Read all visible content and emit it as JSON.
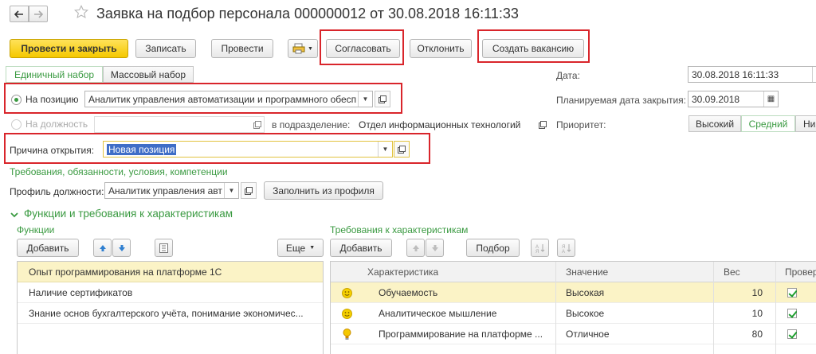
{
  "window": {
    "title": "Заявка на подбор персонала 000000012 от 30.08.2018 16:11:33"
  },
  "toolbar": {
    "post_close": "Провести и закрыть",
    "save": "Записать",
    "post": "Провести",
    "approve": "Согласовать",
    "reject": "Отклонить",
    "create_vacancy": "Создать вакансию"
  },
  "tabs": {
    "single": "Единичный набор",
    "mass": "Массовый набор"
  },
  "position": {
    "radio_label": "На позицию",
    "value": "Аналитик управления автоматизации и программного обесп"
  },
  "job": {
    "radio_label": "На должность",
    "value": "",
    "dept_label": "в подразделение:",
    "dept_value": "Отдел информационных технологий"
  },
  "reason": {
    "label": "Причина открытия:",
    "value": "Новая позиция"
  },
  "requirements_link": "Требования, обязанности, условия, компетенции",
  "profile": {
    "label": "Профиль должности:",
    "value": "Аналитик управления авт",
    "fill_button": "Заполнить из профиля"
  },
  "right": {
    "date_label": "Дата:",
    "date_value": "30.08.2018 16:11:33",
    "close_date_label": "Планируемая дата закрытия:",
    "close_date_value": "30.09.2018",
    "priority_label": "Приоритет:",
    "priority_options": [
      "Высокий",
      "Средний",
      "Ни"
    ]
  },
  "functions_section": {
    "title": "Функции и требования к характеристикам",
    "functions_title": "Функции",
    "add_button": "Добавить",
    "more_button": "Еще",
    "items": [
      "Опыт программирования на платформе 1С",
      "Наличие сертификатов",
      "Знание основ бухгалтерского учёта, понимание экономичес..."
    ]
  },
  "characteristics": {
    "title": "Требования к характеристикам",
    "add_button": "Добавить",
    "pick_button": "Подбор",
    "columns": [
      "Характеристика",
      "Значение",
      "Вес",
      "Провер"
    ],
    "rows": [
      {
        "name": "Обучаемость",
        "value": "Высокая",
        "weight": "10",
        "icon": "smiley-icon"
      },
      {
        "name": "Аналитическое мышление",
        "value": "Высокое",
        "weight": "10",
        "icon": "smiley-icon"
      },
      {
        "name": "Программирование на платформе ...",
        "value": "Отличное",
        "weight": "80",
        "icon": "lightbulb-icon"
      }
    ]
  },
  "colors": {
    "accent_green": "#3a9a41",
    "primary_yellow": "#f5c800",
    "highlight_red": "#d9252b",
    "selected_row": "#fbf3c6"
  }
}
